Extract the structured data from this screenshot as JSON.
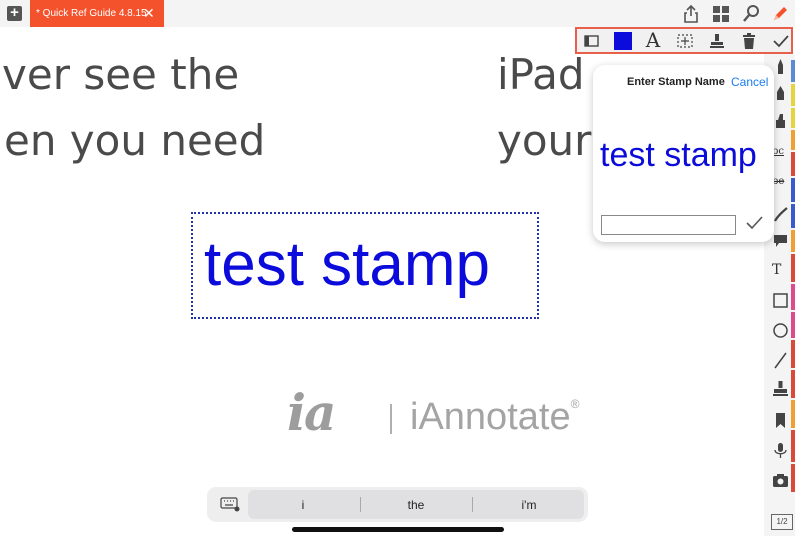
{
  "topbar": {
    "tab_title": "* Quick Ref Guide 4.8.15",
    "tab_close": "✕",
    "add_symbol": "+"
  },
  "document": {
    "lines_left": [
      "ver see the",
      "en you need"
    ],
    "lines_right": [
      "iPad",
      "your"
    ],
    "stamp_text": "test stamp",
    "logo_mark": "ia",
    "logo_name": "iAnnotate",
    "logo_trademark": "®"
  },
  "stamp_toolbar": {
    "font_glyph": "A",
    "selected_color": "#0b0bdb",
    "items": [
      "panel-icon",
      "color-swatch",
      "font-icon",
      "stamp-frame-icon",
      "stamp-icon",
      "trash-icon",
      "checkmark-icon"
    ]
  },
  "popover": {
    "title": "Enter Stamp Name",
    "cancel_label": "Cancel",
    "preview_text": "test stamp",
    "input_value": "",
    "accent_color": "#1a7ef0"
  },
  "keyboard_bar": {
    "suggestions": [
      "i",
      "the",
      "i'm"
    ]
  },
  "sidebar": {
    "text_tool_glyph": "T",
    "strike_label": "be",
    "underline_label": "bc",
    "page_badge": "1/2",
    "tab_colors": [
      "#5b8ad6",
      "#e5d43b",
      "#e5d43b",
      "#f0a030",
      "#d94a3a",
      "#3a5bd0",
      "#3a5bd0",
      "#f0a030",
      "#d94a3a",
      "#e04a8a",
      "#e04a8a",
      "#d94a3a",
      "#d94a3a",
      "#f0a030",
      "#d94a3a",
      "#d94a3a"
    ]
  }
}
